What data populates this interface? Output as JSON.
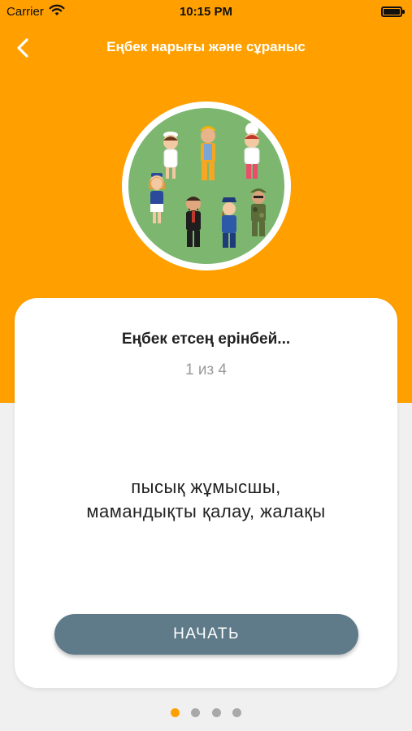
{
  "status_bar": {
    "carrier": "Carrier",
    "time": "10:15 PM"
  },
  "nav": {
    "title": "Еңбек нарығы және сұраныс",
    "back_icon": "chevron-left-icon"
  },
  "hero": {
    "image": "professions-illustration"
  },
  "card": {
    "title": "Еңбек етсең ерінбей...",
    "counter": "1 из 4",
    "body_line1": "пысық жұмысшы,",
    "body_line2": "мамандықты қалау, жалақы",
    "start_label": "НАЧАТЬ"
  },
  "pager": {
    "count": 4,
    "active_index": 0
  },
  "colors": {
    "accent": "#ffa000",
    "button": "#5f7b8a",
    "background": "#f0f0f0"
  }
}
